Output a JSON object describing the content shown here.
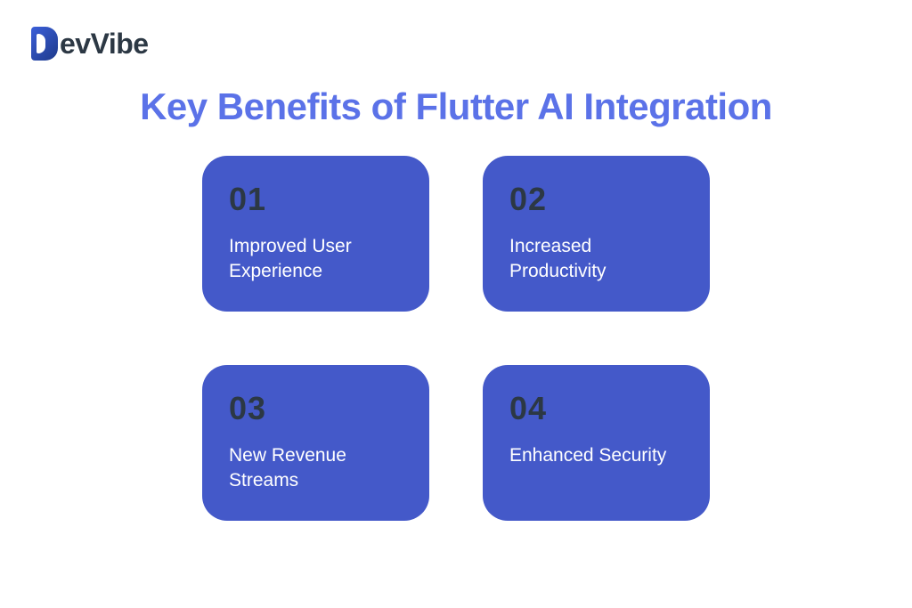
{
  "logo": {
    "text": "evVibe"
  },
  "title": "Key Benefits of Flutter AI Integration",
  "cards": [
    {
      "number": "01",
      "label": "Improved User Experience"
    },
    {
      "number": "02",
      "label": "Increased Productivity"
    },
    {
      "number": "03",
      "label": "New Revenue Streams"
    },
    {
      "number": "04",
      "label": "Enhanced Security"
    }
  ]
}
